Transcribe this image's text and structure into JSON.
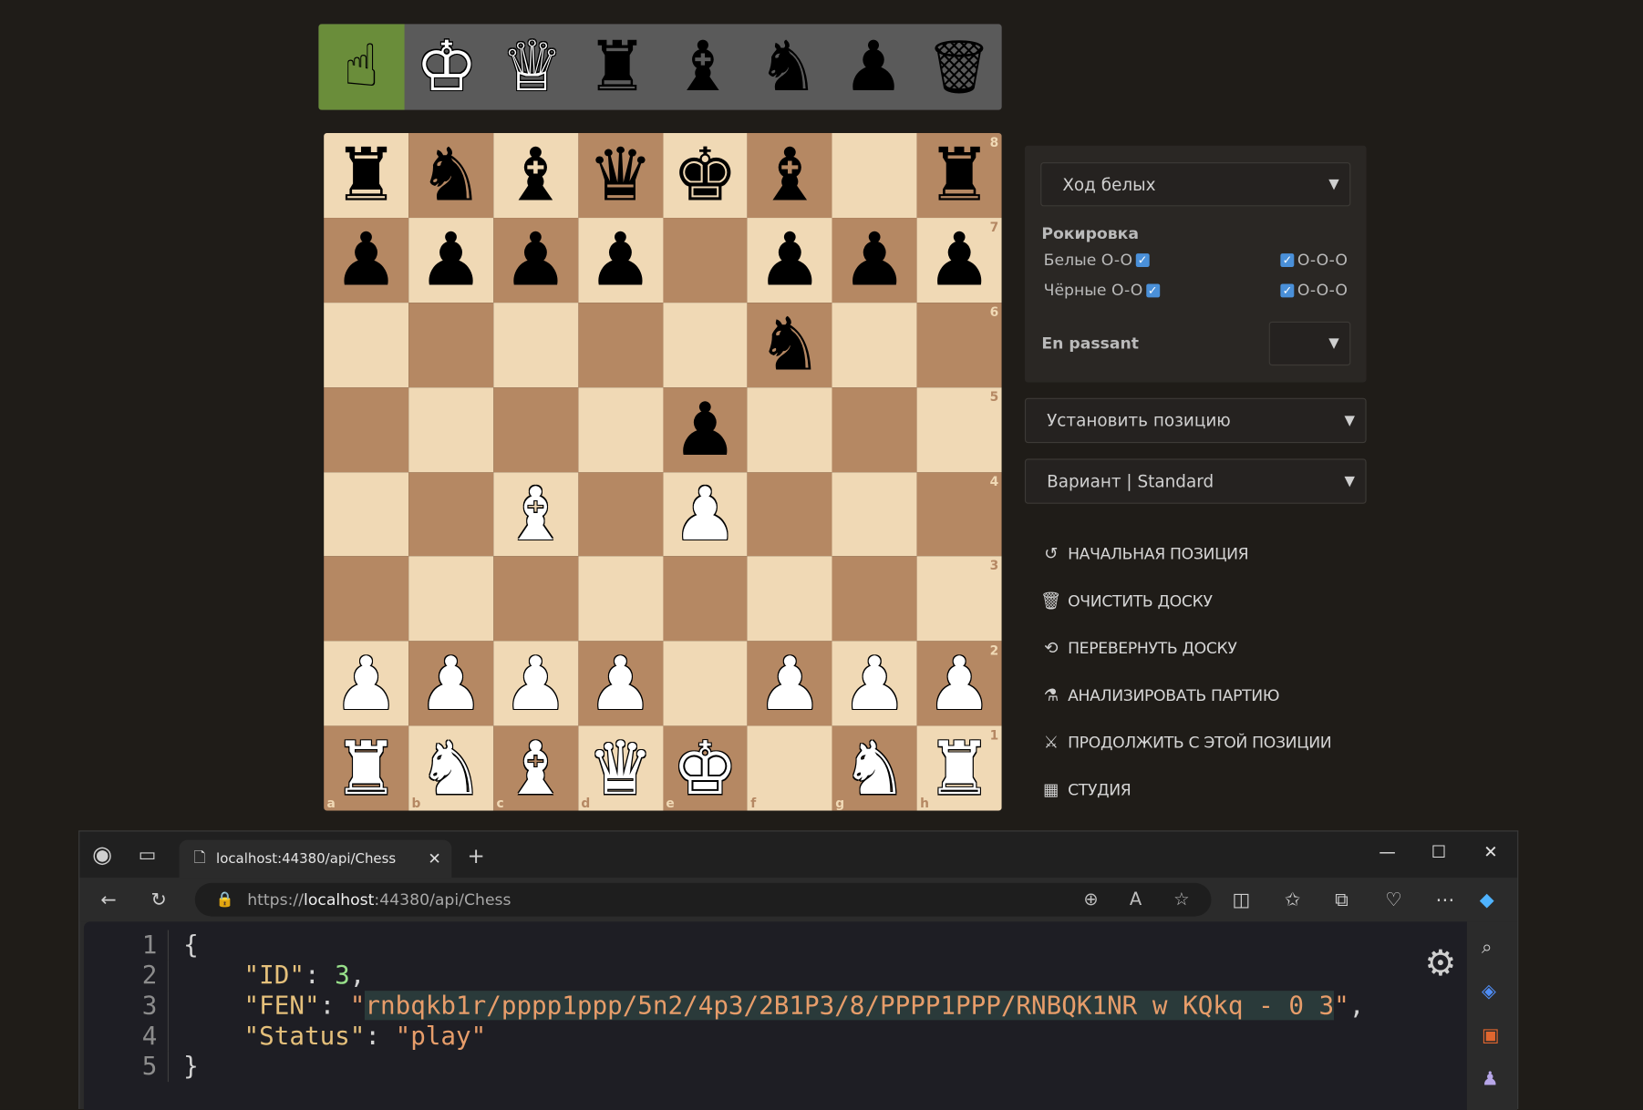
{
  "toolbar": {
    "tools": [
      {
        "name": "pointer-tool",
        "glyph": "☝",
        "active": true
      },
      {
        "name": "king-tool",
        "glyph": "♔",
        "active": false
      },
      {
        "name": "queen-tool",
        "glyph": "♕",
        "active": false
      },
      {
        "name": "rook-tool",
        "glyph": "♜",
        "active": false
      },
      {
        "name": "bishop-tool",
        "glyph": "♝",
        "active": false
      },
      {
        "name": "knight-tool",
        "glyph": "♞",
        "active": false
      },
      {
        "name": "pawn-tool",
        "glyph": "♟",
        "active": false
      },
      {
        "name": "trash-tool",
        "glyph": "🗑",
        "active": false
      }
    ]
  },
  "board": {
    "rows": [
      [
        "bR",
        "bN",
        "bB",
        "bQ",
        "bK",
        "bB",
        "",
        "bR"
      ],
      [
        "bP",
        "bP",
        "bP",
        "bP",
        "",
        "bP",
        "bP",
        "bP"
      ],
      [
        "",
        "",
        "",
        "",
        "",
        "bN",
        "",
        ""
      ],
      [
        "",
        "",
        "",
        "",
        "bP",
        "",
        "",
        ""
      ],
      [
        "",
        "",
        "wB",
        "",
        "wP",
        "",
        "",
        ""
      ],
      [
        "",
        "",
        "",
        "",
        "",
        "",
        "",
        ""
      ],
      [
        "wP",
        "wP",
        "wP",
        "wP",
        "",
        "wP",
        "wP",
        "wP"
      ],
      [
        "wR",
        "wN",
        "wB",
        "wQ",
        "wK",
        "",
        "wN",
        "wR"
      ]
    ],
    "ranks": [
      "8",
      "7",
      "6",
      "5",
      "4",
      "3",
      "2",
      "1"
    ],
    "files": [
      "a",
      "b",
      "c",
      "d",
      "e",
      "f",
      "g",
      "h"
    ]
  },
  "panel": {
    "turn_select": "Ход белых",
    "castling_title": "Рокировка",
    "white_label": "Белые O-O",
    "black_label": "Чёрные O-O",
    "ooo_label": "O-O-O",
    "en_passant_label": "En passant",
    "set_position_select": "Установить позицию",
    "variant_select": "Вариант | Standard"
  },
  "actions": [
    {
      "name": "action-initial-position",
      "icon": "↺",
      "label": "НАЧАЛЬНАЯ ПОЗИЦИЯ"
    },
    {
      "name": "action-clear-board",
      "icon": "🗑",
      "label": "ОЧИСТИТЬ ДОСКУ"
    },
    {
      "name": "action-flip-board",
      "icon": "⟲",
      "label": "ПЕРЕВЕРНУТЬ ДОСКУ"
    },
    {
      "name": "action-analyze-game",
      "icon": "⚗",
      "label": "АНАЛИЗИРОВАТЬ ПАРТИЮ"
    },
    {
      "name": "action-continue-from-position",
      "icon": "⚔",
      "label": "ПРОДОЛЖИТЬ С ЭТОЙ ПОЗИЦИИ"
    },
    {
      "name": "action-studio",
      "icon": "▦",
      "label": "СТУДИЯ"
    }
  ],
  "browser": {
    "tab_title": "localhost:44380/api/Chess",
    "url_scheme": "https://",
    "url_host": "localhost",
    "url_rest": ":44380/api/Chess"
  },
  "json_view": {
    "lines": [
      "1",
      "2",
      "3",
      "4",
      "5"
    ],
    "open_brace": "{",
    "close_brace": "}",
    "id_key": "\"ID\"",
    "id_value": "3",
    "fen_key": "\"FEN\"",
    "fen_value": "rnbqkb1r/pppp1ppp/5n2/4p3/2B1P3/8/PPPP1PPP/RNBQK1NR w KQkq - 0 3",
    "status_key": "\"Status\"",
    "status_value": "\"play\""
  }
}
